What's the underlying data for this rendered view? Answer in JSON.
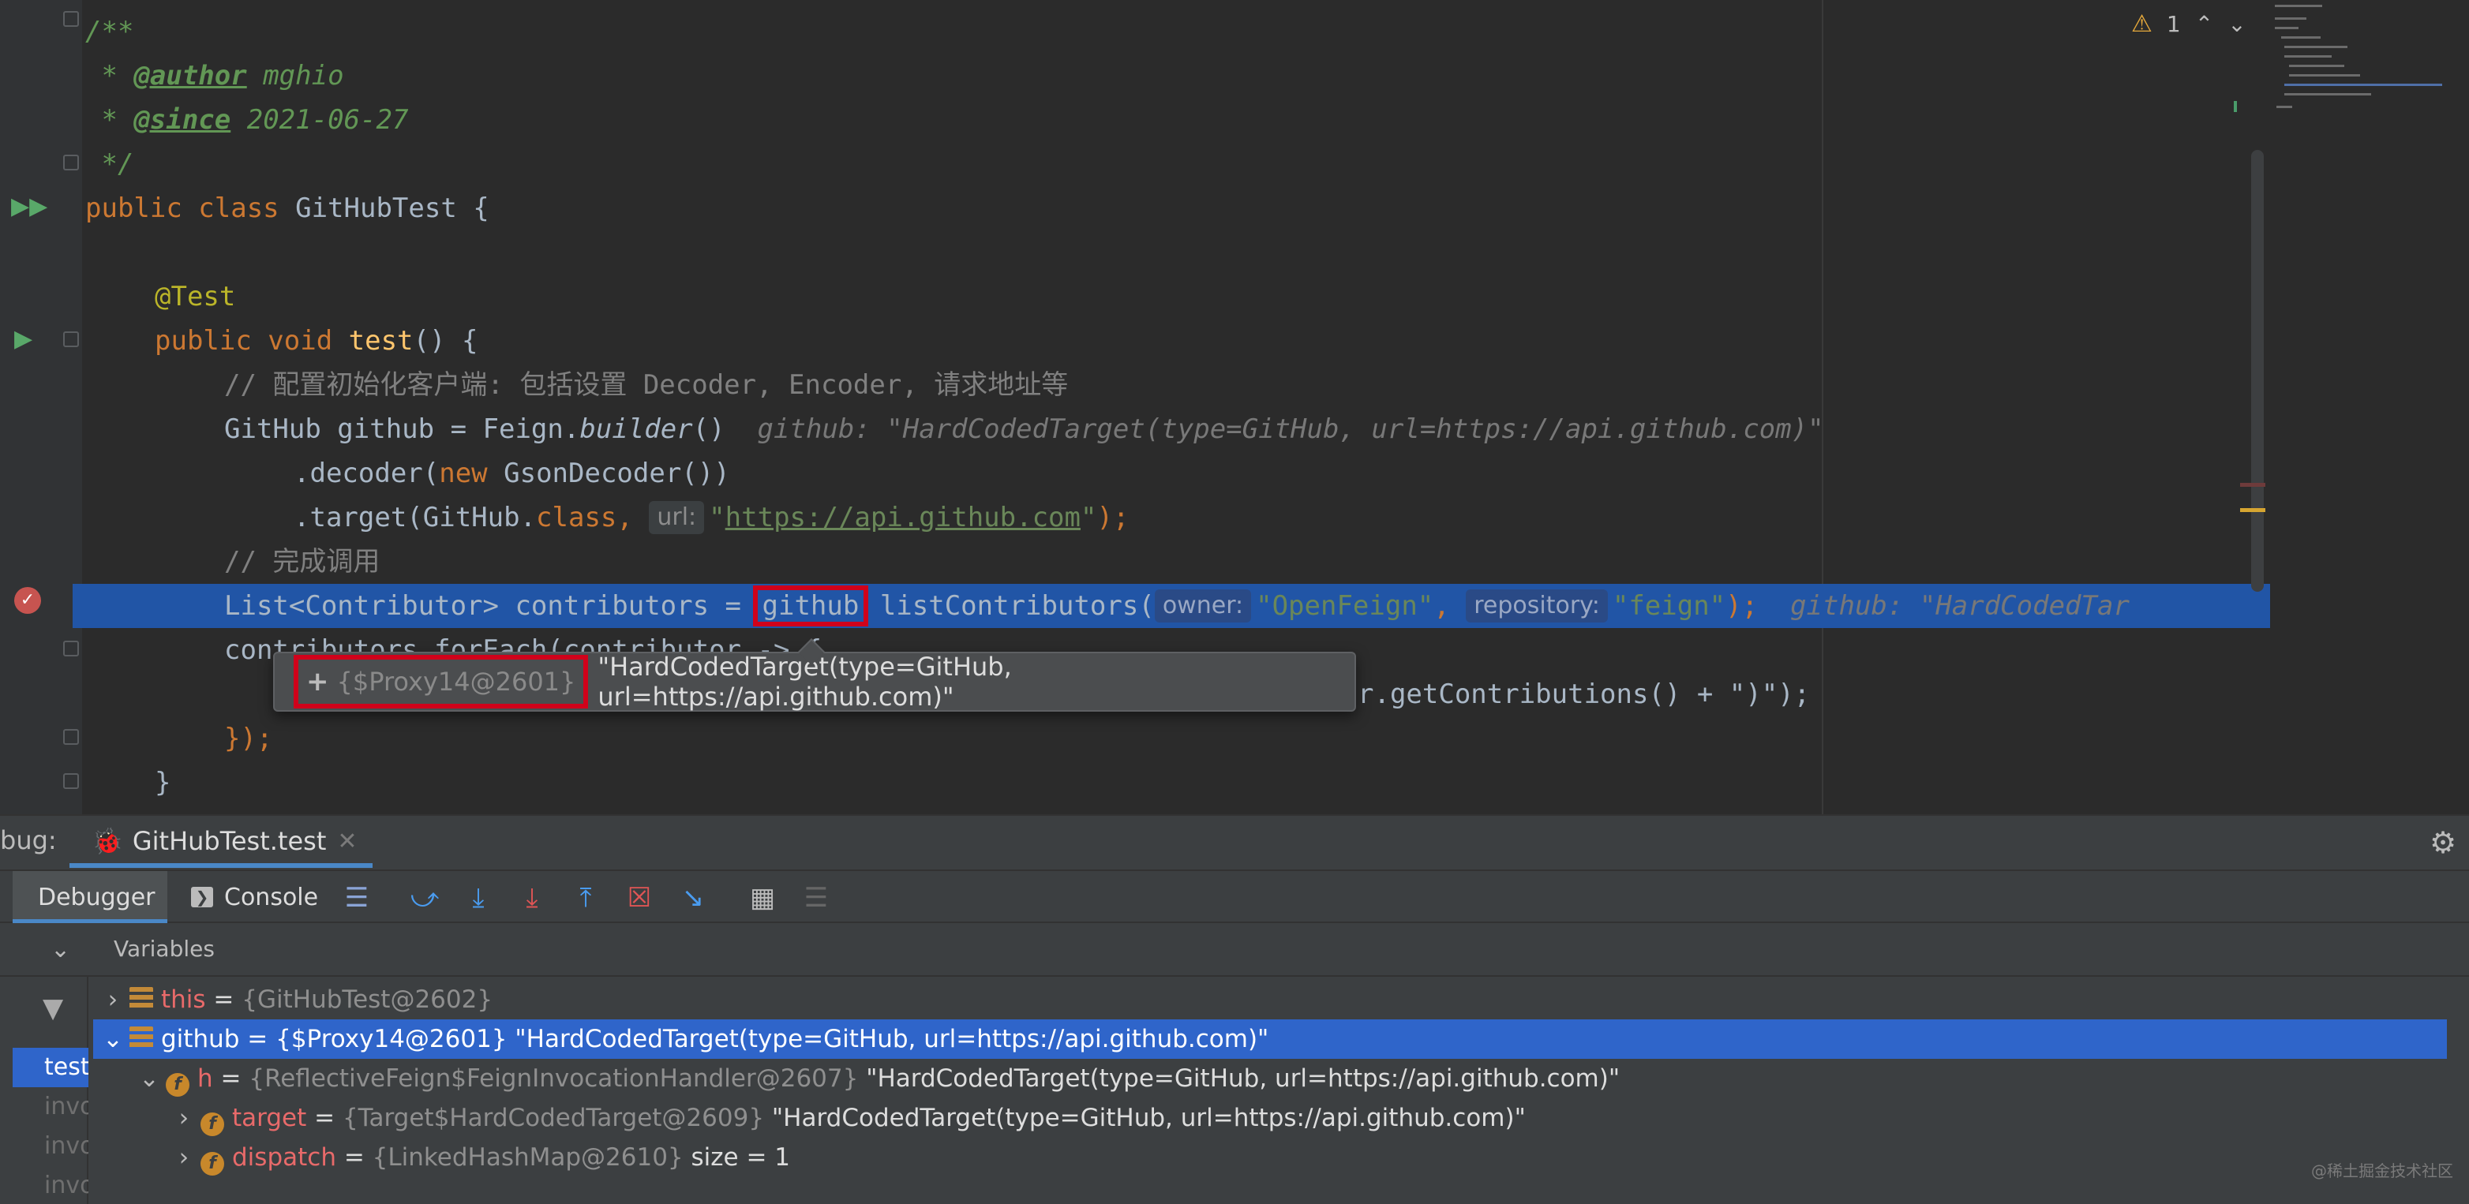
{
  "editor": {
    "lines": {
      "doc_open": "/**",
      "author_prefix": " * ",
      "author_tag": "@author",
      "author_value": " mghio",
      "since_prefix": " * ",
      "since_tag": "@since",
      "since_value": " 2021-06-27",
      "doc_close": " */",
      "class_kw": "public class ",
      "class_name": "GitHubTest {",
      "annotation": "@Test",
      "method_kw": "public void ",
      "method_name": "test",
      "method_rest": "() {",
      "comment1": "// 配置初始化客户端: 包括设置 Decoder, Encoder, 请求地址等",
      "decl_a": "GitHub github = Feign.",
      "decl_builder": "builder",
      "decl_b": "()",
      "decl_hint": "github: \"HardCodedTarget(type=GitHub, url=https://api.github.com)\"",
      "decoder_a": ".decoder(",
      "decoder_new": "new",
      "decoder_b": " GsonDecoder())",
      "target_a": ".target(GitHub.",
      "target_class": "class",
      "target_comma": ",",
      "target_inlay": "url:",
      "target_q1": "\"",
      "target_url": "https://api.github.com",
      "target_q2": "\"",
      "target_end": ");",
      "comment2": "// 完成调用",
      "call_a": "List<Contributor> contributors = ",
      "call_var": "github",
      "call_b": "listContributors(",
      "call_inlay_owner": "owner:",
      "call_owner": "\"OpenFeign\"",
      "call_comma": ", ",
      "call_inlay_repo": "repository:",
      "call_repo": "\"feign\"",
      "call_end": ");",
      "call_hint": "github: \"HardCodedTar",
      "foreach": "contributors.forEach(contributor -> {",
      "print_tail": "r.getContributions() + \")\");",
      "close_lambda": "});",
      "close_method": "}"
    },
    "warnings": {
      "count": "1"
    }
  },
  "tooltip": {
    "plus": "+",
    "ref": "{$Proxy14@2601}",
    "value": "\"HardCodedTarget(type=GitHub, url=https://api.github.com)\""
  },
  "debug": {
    "title": "bug:",
    "session_tab": "GitHubTest.test",
    "tabs": {
      "debugger": "Debugger",
      "console": "Console"
    },
    "variables_label": "Variables",
    "frames": [
      "test",
      "invo",
      "invo",
      "invo"
    ],
    "variables": [
      {
        "name": "this",
        "eq": " = ",
        "ref": "{GitHubTest@2602}",
        "value": ""
      },
      {
        "name": "github",
        "eq": " = ",
        "ref": "{$Proxy14@2601}",
        "value": " \"HardCodedTarget(type=GitHub, url=https://api.github.com)\""
      },
      {
        "name": "h",
        "eq": " = ",
        "ref": "{ReflectiveFeign$FeignInvocationHandler@2607}",
        "value": " \"HardCodedTarget(type=GitHub, url=https://api.github.com)\""
      },
      {
        "name": "target",
        "eq": " = ",
        "ref": "{Target$HardCodedTarget@2609}",
        "value": " \"HardCodedTarget(type=GitHub, url=https://api.github.com)\""
      },
      {
        "name": "dispatch",
        "eq": " = ",
        "ref": "{LinkedHashMap@2610}",
        "value": " size = 1"
      }
    ],
    "watermark": "@稀土掘金技术社区"
  },
  "colors": {
    "editor_bg": "#2b2b2b",
    "selection": "#2155a6",
    "tree_selection": "#2f65ca",
    "callout": "#d0021b",
    "keyword": "#cc7832",
    "string": "#6a8759"
  },
  "icons": [
    "warning-icon",
    "chevron-up-icon",
    "chevron-down-icon",
    "run-icon",
    "breakpoint-icon",
    "gear-icon",
    "console-icon",
    "filter-icon",
    "step-over-icon",
    "step-into-icon",
    "step-out-icon",
    "calculator-icon"
  ]
}
